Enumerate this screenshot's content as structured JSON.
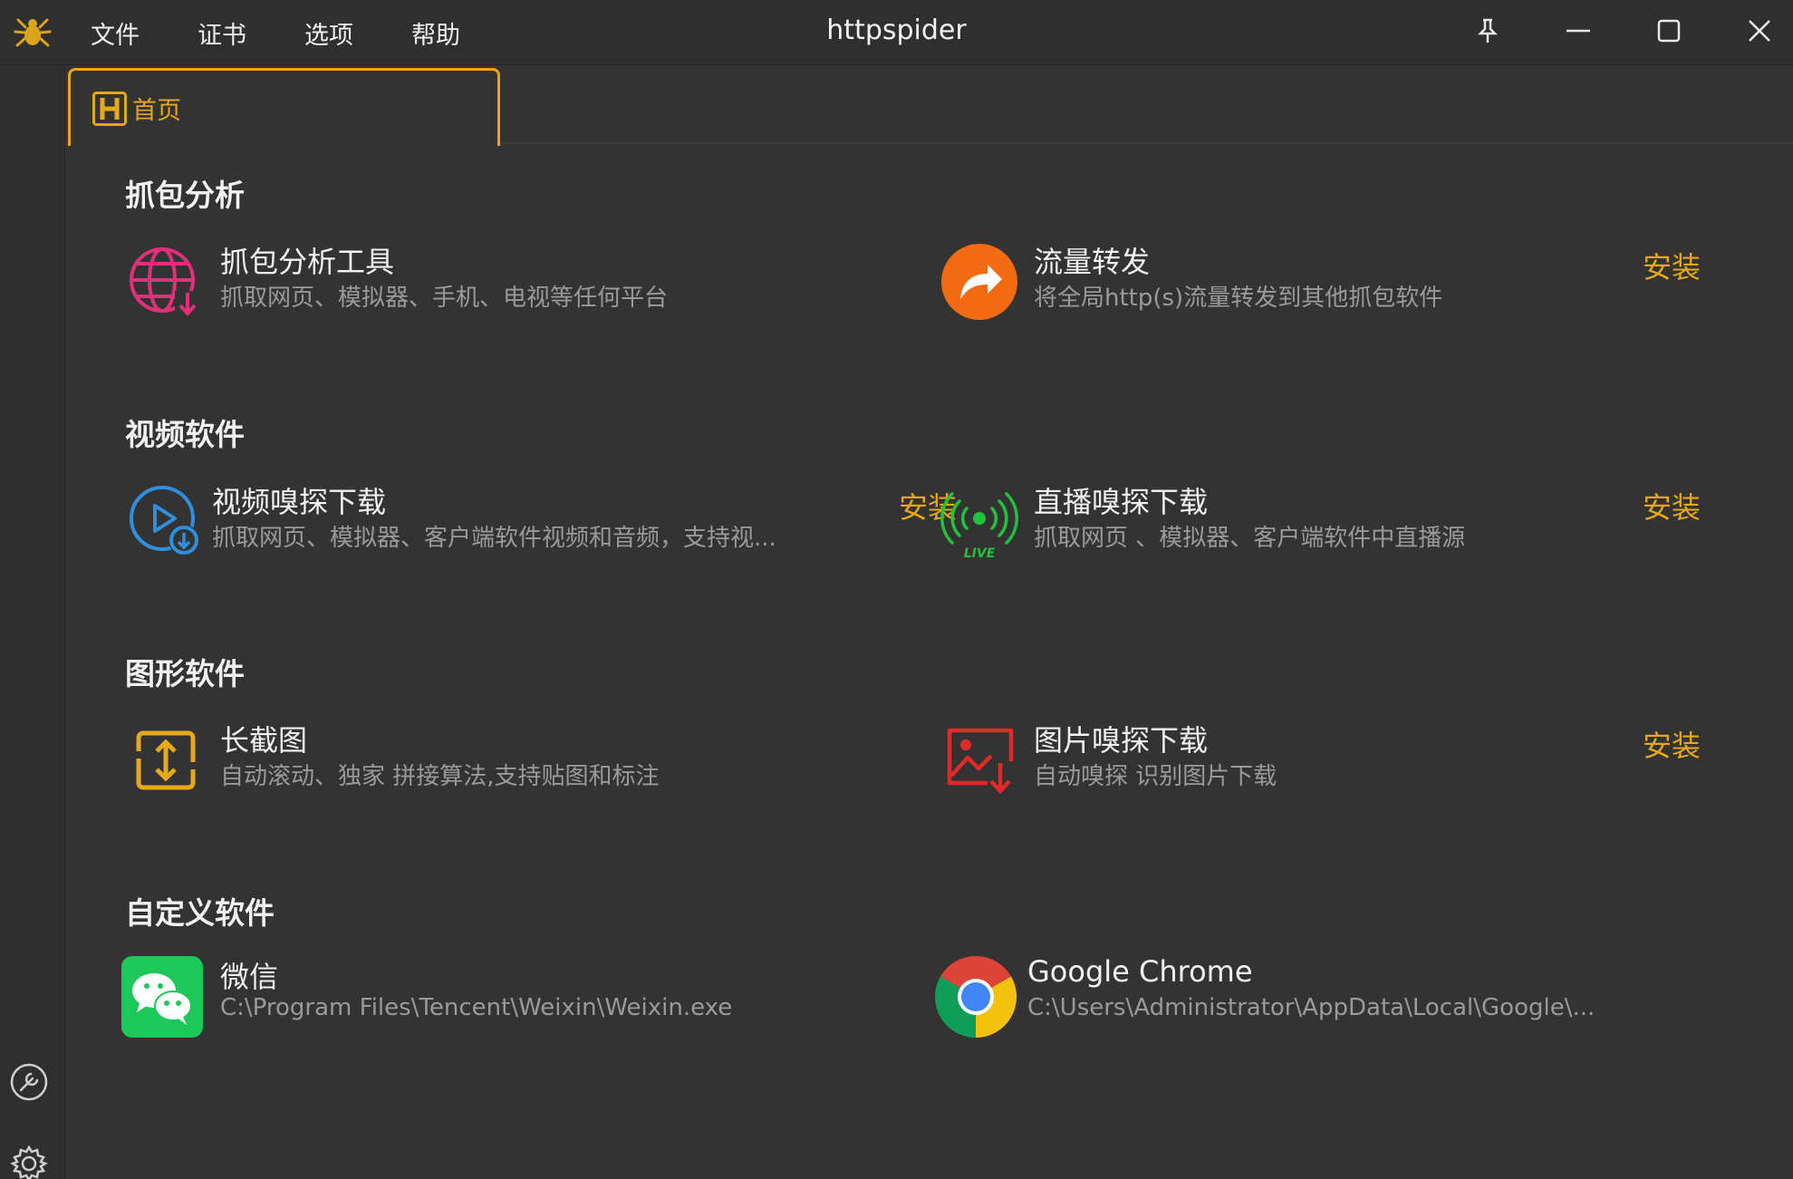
{
  "window": {
    "title": "httpspider"
  },
  "menu": {
    "items": [
      "文件",
      "证书",
      "选项",
      "帮助"
    ]
  },
  "icons": {
    "app": "spider-icon",
    "pin": "pin-icon",
    "minimize": "minimize-icon",
    "maximize": "maximize-icon",
    "close": "close-icon",
    "tools": "wrench-icon",
    "settings": "gear-icon"
  },
  "tabs": [
    {
      "label": "首页",
      "icon": "h-badge-icon"
    }
  ],
  "accent_color": "#e6a817",
  "sections": [
    {
      "title": "抓包分析",
      "items": [
        {
          "name": "抓包分析工具",
          "desc": "抓取网页、模拟器、手机、电视等任何平台",
          "icon": "globe-download-icon",
          "action": ""
        },
        {
          "name": "流量转发",
          "desc": "将全局http(s)流量转发到其他抓包软件",
          "icon": "forward-arrow-icon",
          "action": "安装"
        }
      ]
    },
    {
      "title": "视频软件",
      "items": [
        {
          "name": "视频嗅探下载",
          "desc": "抓取网页、模拟器、客户端软件视频和音频，支持视...",
          "icon": "video-download-icon",
          "action": "安装"
        },
        {
          "name": "直播嗅探下载",
          "desc": "抓取网页 、模拟器、客户端软件中直播源",
          "icon": "live-broadcast-icon",
          "action": "安装"
        }
      ]
    },
    {
      "title": "图形软件",
      "items": [
        {
          "name": "长截图",
          "desc": "自动滚动、独家 拼接算法,支持贴图和标注",
          "icon": "long-screenshot-icon",
          "action": ""
        },
        {
          "name": "图片嗅探下载",
          "desc": "自动嗅探 识别图片下载",
          "icon": "image-download-icon",
          "action": "安装"
        }
      ]
    },
    {
      "title": "自定义软件",
      "items": [
        {
          "name": "微信",
          "desc": "C:\\Program Files\\Tencent\\Weixin\\Weixin.exe",
          "icon": "wechat-icon",
          "action": ""
        },
        {
          "name": "Google Chrome",
          "desc": "C:\\Users\\Administrator\\AppData\\Local\\Google\\...",
          "icon": "chrome-icon",
          "action": ""
        }
      ]
    }
  ]
}
